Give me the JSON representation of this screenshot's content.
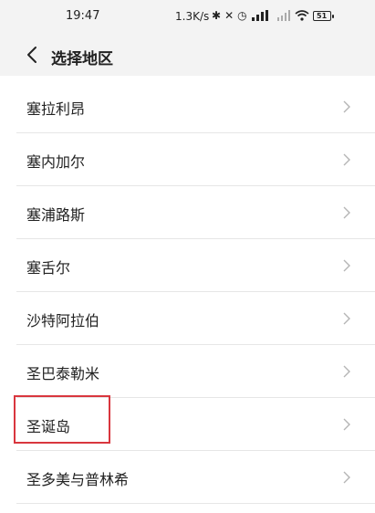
{
  "status_bar": {
    "time": "19:47",
    "net_speed": "1.3K/s",
    "battery": "51"
  },
  "header": {
    "title": "选择地区"
  },
  "regions": [
    {
      "label": "塞拉利昂"
    },
    {
      "label": "塞内加尔"
    },
    {
      "label": "塞浦路斯"
    },
    {
      "label": "塞舌尔"
    },
    {
      "label": "沙特阿拉伯"
    },
    {
      "label": "圣巴泰勒米"
    },
    {
      "label": "圣诞岛"
    },
    {
      "label": "圣多美与普林希"
    }
  ],
  "colors": {
    "header_bg": "#f3f3f3",
    "divider": "#e6e6e6",
    "highlight_box": "#d9363e"
  },
  "icons": {
    "back": "chevron-left-icon",
    "row_arrow": "chevron-right-icon"
  }
}
